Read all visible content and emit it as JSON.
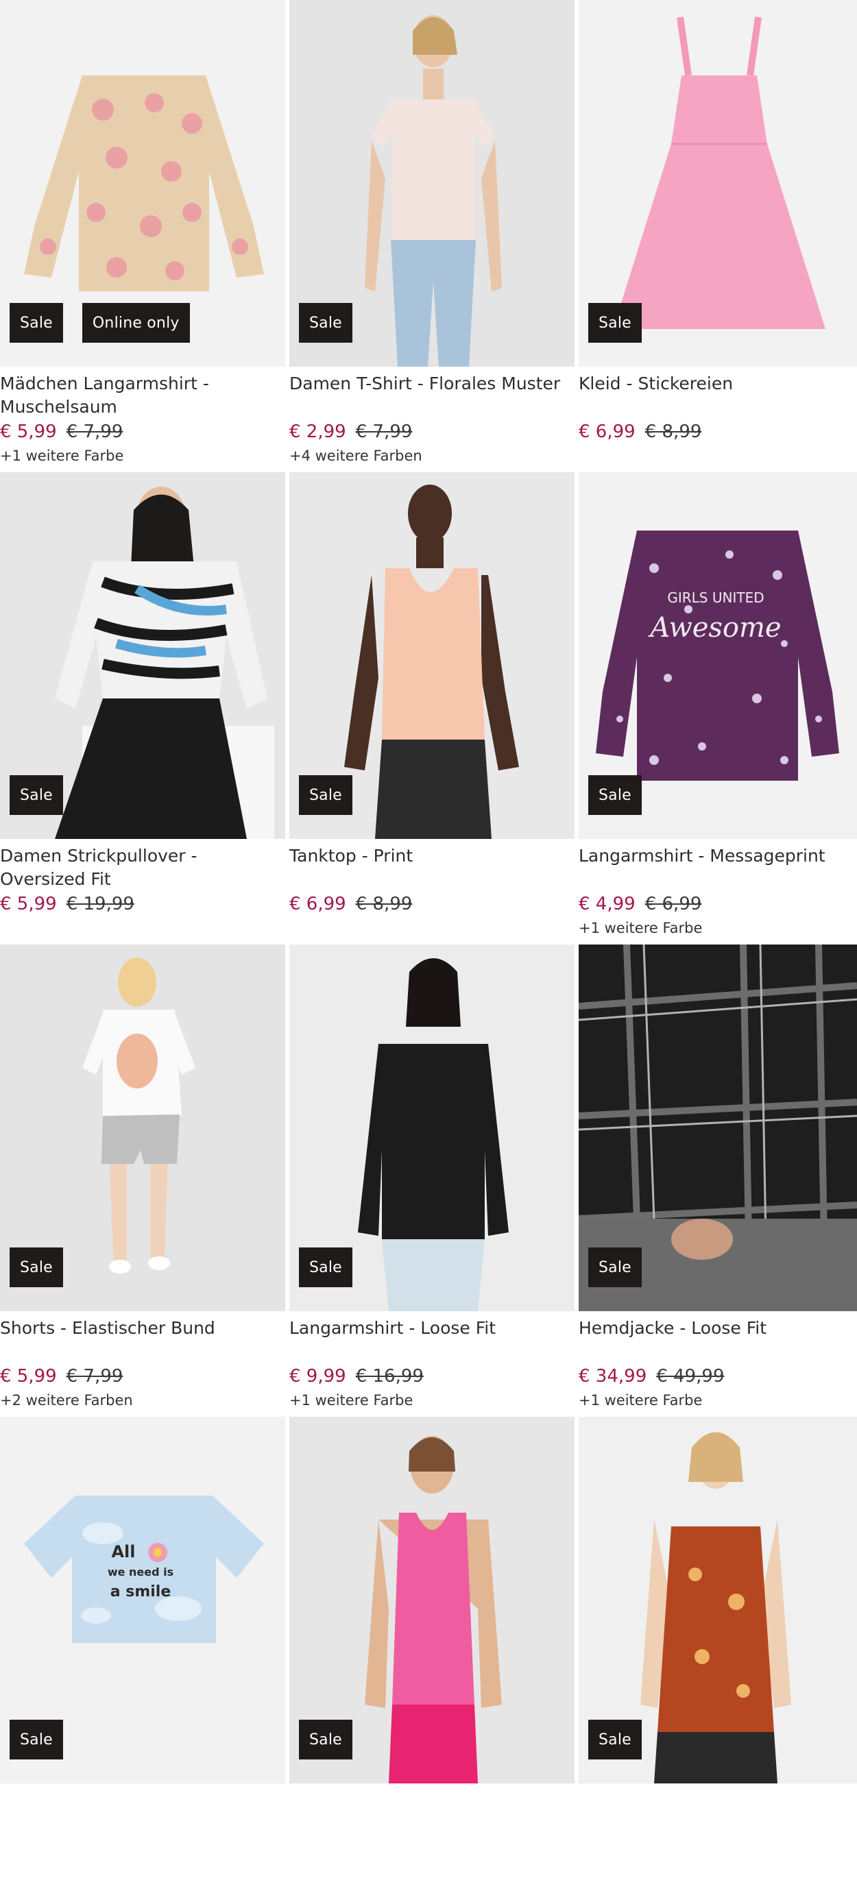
{
  "products": [
    {
      "title": "Mädchen Langarmshirt - Muschelsaum",
      "price": "€ 5,99",
      "old_price": "€ 7,99",
      "badges": [
        "Sale",
        "Online only"
      ],
      "colors": "+1 weitere Farbe"
    },
    {
      "title": "Damen T-Shirt - Florales Muster",
      "price": "€ 2,99",
      "old_price": "€ 7,99",
      "badges": [
        "Sale"
      ],
      "colors": "+4 weitere Farben"
    },
    {
      "title": "Kleid - Stickereien",
      "price": "€ 6,99",
      "old_price": "€ 8,99",
      "badges": [
        "Sale"
      ],
      "colors": ""
    },
    {
      "title": "Damen Strickpullover - Oversized Fit",
      "price": "€ 5,99",
      "old_price": "€ 19,99",
      "badges": [
        "Sale"
      ],
      "colors": ""
    },
    {
      "title": "Tanktop - Print",
      "price": "€ 6,99",
      "old_price": "€ 8,99",
      "badges": [
        "Sale"
      ],
      "colors": ""
    },
    {
      "title": "Langarmshirt - Messageprint",
      "price": "€ 4,99",
      "old_price": "€ 6,99",
      "badges": [
        "Sale"
      ],
      "colors": "+1 weitere Farbe"
    },
    {
      "title": "Shorts - Elastischer Bund",
      "price": "€ 5,99",
      "old_price": "€ 7,99",
      "badges": [
        "Sale"
      ],
      "colors": "+2 weitere Farben"
    },
    {
      "title": "Langarmshirt - Loose Fit",
      "price": "€ 9,99",
      "old_price": "€ 16,99",
      "badges": [
        "Sale"
      ],
      "colors": "+1 weitere Farbe"
    },
    {
      "title": "Hemdjacke - Loose Fit",
      "price": "€ 34,99",
      "old_price": "€ 49,99",
      "badges": [
        "Sale"
      ],
      "colors": "+1 weitere Farbe"
    },
    {
      "title": "",
      "price": "",
      "old_price": "",
      "badges": [
        "Sale"
      ],
      "colors": ""
    },
    {
      "title": "",
      "price": "",
      "old_price": "",
      "badges": [
        "Sale"
      ],
      "colors": ""
    },
    {
      "title": "",
      "price": "",
      "old_price": "",
      "badges": [
        "Sale"
      ],
      "colors": ""
    }
  ],
  "print_texts": {
    "tshirt_line1": "All",
    "tshirt_line2": "we need is",
    "tshirt_line3": "a smile",
    "longsleeve_line1": "GIRLS UNITED",
    "longsleeve_line2": "Awesome"
  },
  "colors": {
    "sale_price": "#a2174a",
    "badge_bg": "#1f1b1b",
    "badge_text": "#ffffff"
  }
}
